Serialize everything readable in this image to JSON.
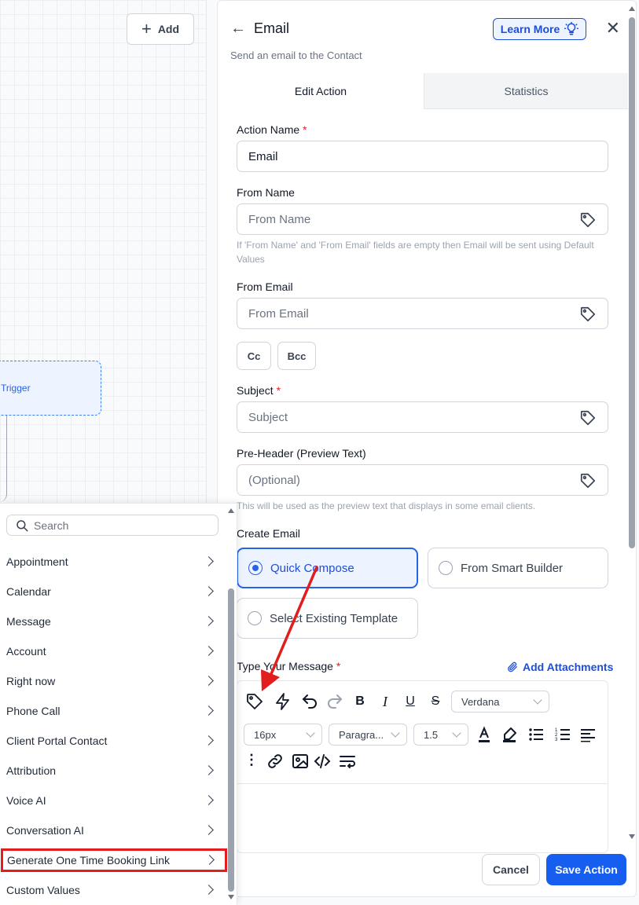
{
  "canvas": {
    "add_label": "Add",
    "trigger_label": "Trigger"
  },
  "panel": {
    "title": "Email",
    "subtitle": "Send an email to the Contact",
    "learn_more": "Learn More",
    "tabs": [
      {
        "label": "Edit Action",
        "active": true
      },
      {
        "label": "Statistics",
        "active": false
      }
    ],
    "action_name": {
      "label": "Action Name",
      "required_mark": "*",
      "value": "Email"
    },
    "from_name": {
      "label": "From Name",
      "placeholder": "From Name",
      "help": "If 'From Name' and 'From Email' fields are empty then Email will be sent using Default Values"
    },
    "from_email": {
      "label": "From Email",
      "placeholder": "From Email"
    },
    "cc_label": "Cc",
    "bcc_label": "Bcc",
    "subject": {
      "label": "Subject",
      "required_mark": "*",
      "placeholder": "Subject"
    },
    "preheader": {
      "label": "Pre-Header (Preview Text)",
      "placeholder": "(Optional)",
      "help": "This will be used as the preview text that displays in some email clients."
    },
    "create_email": {
      "label": "Create Email",
      "options": [
        {
          "label": "Quick Compose",
          "selected": true
        },
        {
          "label": "From Smart Builder",
          "selected": false
        },
        {
          "label": "Select Existing Template",
          "selected": false
        }
      ]
    },
    "message": {
      "label": "Type Your Message",
      "required_mark": "*",
      "add_attachments": "Add Attachments"
    },
    "editor": {
      "font_family": "Verdana",
      "font_size": "16px",
      "block_format": "Paragra...",
      "line_height": "1.5",
      "icons": [
        "tag-icon",
        "lightning-icon",
        "undo-icon",
        "redo-icon",
        "bold-icon",
        "italic-icon",
        "underline-icon",
        "strikethrough-icon",
        "text-color-icon",
        "highlight-icon",
        "bullet-list-icon",
        "numbered-list-icon",
        "align-icon",
        "more-vertical-icon",
        "link-icon",
        "image-icon",
        "code-icon",
        "wrap-text-icon"
      ]
    },
    "footer": {
      "cancel": "Cancel",
      "save": "Save Action"
    }
  },
  "menu": {
    "search_placeholder": "Search",
    "items": [
      {
        "label": "Appointment"
      },
      {
        "label": "Calendar"
      },
      {
        "label": "Message"
      },
      {
        "label": "Account"
      },
      {
        "label": "Right now"
      },
      {
        "label": "Phone Call"
      },
      {
        "label": "Client Portal Contact"
      },
      {
        "label": "Attribution"
      },
      {
        "label": "Voice AI"
      },
      {
        "label": "Conversation AI"
      },
      {
        "label": "Generate One Time Booking Link",
        "highlighted": true
      },
      {
        "label": "Custom Values"
      }
    ]
  },
  "colors": {
    "primary": "#155eef",
    "accent_text": "#1d4ed8",
    "highlight_box": "#e11d1d",
    "annotation_arrow": "#e11d1d"
  }
}
